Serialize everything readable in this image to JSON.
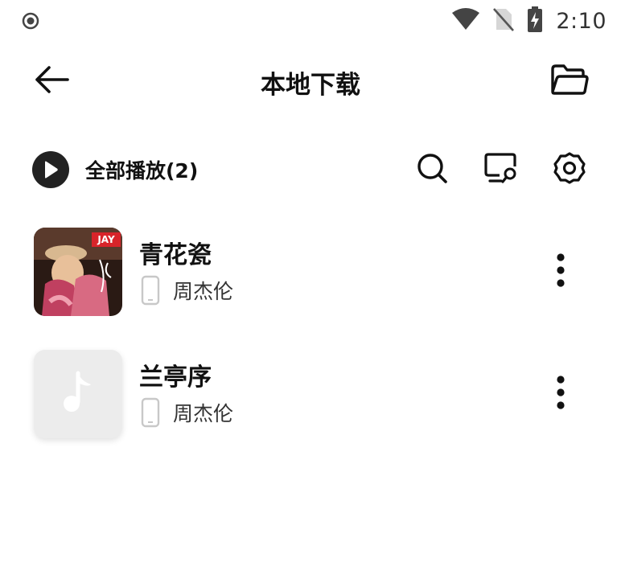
{
  "status_bar": {
    "time": "2:10",
    "icons": [
      "notification-dot-icon",
      "wifi-icon",
      "no-sim-icon",
      "battery-charging-icon"
    ]
  },
  "app_bar": {
    "title": "本地下载",
    "back_icon": "arrow-left-icon",
    "folder_icon": "folder-open-icon"
  },
  "toolbar": {
    "play_all_label": "全部播放(2)",
    "icons": [
      "play-circle-icon",
      "search-icon",
      "screen-scan-icon",
      "settings-gear-icon"
    ]
  },
  "songs": [
    {
      "title": "青花瓷",
      "artist": "周杰伦",
      "cover": "album-art",
      "cover_badge": "JAY",
      "source_icon": "phone-icon"
    },
    {
      "title": "兰亭序",
      "artist": "周杰伦",
      "cover": "music-note-placeholder",
      "source_icon": "phone-icon"
    }
  ],
  "colors": {
    "text_primary": "#111111",
    "text_secondary": "#333333",
    "play_circle": "#222222",
    "placeholder_bg": "#ececec",
    "badge_red": "#d8242a"
  }
}
